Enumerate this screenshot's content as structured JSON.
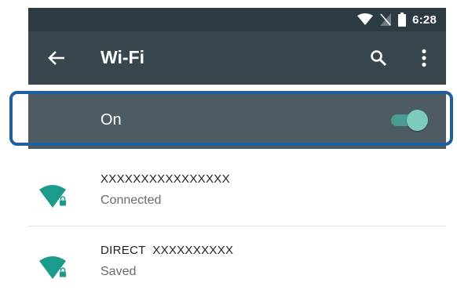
{
  "status_bar": {
    "time": "6:28",
    "icons": [
      "wifi-signal-icon",
      "no-sim-icon",
      "battery-icon"
    ]
  },
  "toolbar": {
    "title": "Wi-Fi",
    "icons": [
      "back-arrow-icon",
      "search-icon",
      "more-vert-icon"
    ]
  },
  "wifi_switch": {
    "label": "On",
    "enabled": true,
    "toggle_color": "#7dcbbf"
  },
  "networks": [
    {
      "ssid": "XXXXXXXXXXXXXXXX",
      "status": "Connected",
      "icon": "wifi-lock-icon"
    },
    {
      "ssid": "DIRECT  XXXXXXXXXX",
      "status": "Saved",
      "icon": "wifi-lock-icon"
    }
  ],
  "colors": {
    "status_bar": "#2c3a41",
    "toolbar": "#38474e",
    "switch_bar": "#4d5c63",
    "accent": "#1a9b8c",
    "highlight": "#1d5fa2"
  }
}
